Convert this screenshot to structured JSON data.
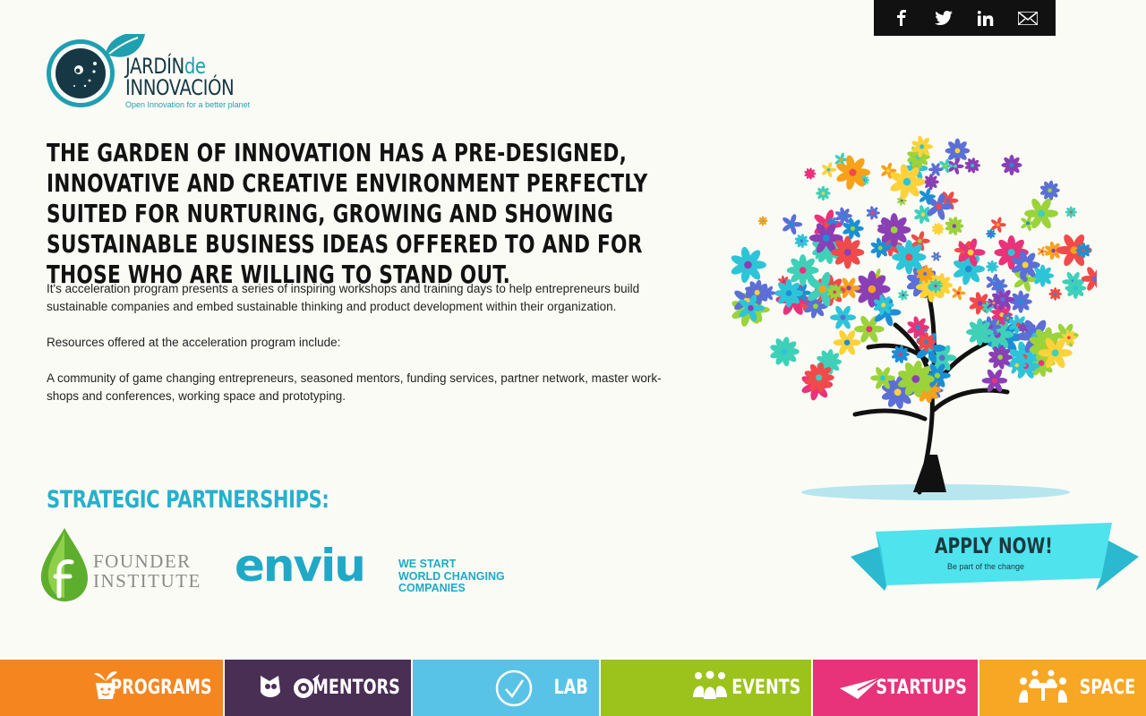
{
  "social": {
    "items": [
      {
        "name": "facebook",
        "icon": "facebook-icon"
      },
      {
        "name": "twitter",
        "icon": "twitter-icon"
      },
      {
        "name": "linkedin",
        "icon": "linkedin-icon"
      },
      {
        "name": "email",
        "icon": "mail-icon"
      }
    ]
  },
  "logo": {
    "word_jardin": "JARDÍN",
    "word_de": "de",
    "word_innovacion": "INNOVACIÓN",
    "tagline": "Open Innovation for a better planet"
  },
  "headline": "The Garden of Innovation has a pre-designed, innovative and creative environment perfectly suited for nurturing, growing and showing sustainable business ideas offered to and for those who are willing to stand out.",
  "body": {
    "p1": "It's acceleration program presents a series of inspiring workshops and training days to help entrepreneurs build sustainable companies and embed sustainable thinking and product development within their organization.",
    "p2": "Resources offered at the acceleration program include:",
    "p3": "A community of game changing entrepreneurs, seasoned mentors, funding services, partner network, master work-shops and conferences, working space and prototyping."
  },
  "partners": {
    "title": "Strategic Partnerships:",
    "founder_institute": {
      "line1": "FOUNDER",
      "line2": "INSTITUTE"
    },
    "enviu": {
      "word": "enviu",
      "tag1": "WE START",
      "tag2": "WORLD CHANGING",
      "tag3": "COMPANIES"
    }
  },
  "apply": {
    "title": "APPLY NOW!",
    "subtitle": "Be part of the change"
  },
  "nav": [
    {
      "label": "PROGRAMS",
      "color": "#f5861f",
      "icon": "seedling-pot-icon"
    },
    {
      "label": "MENTORS",
      "color": "#4a2f55",
      "icon": "owl-icon"
    },
    {
      "label": "LAB",
      "color": "#58c3e6",
      "icon": "check-circle-icon"
    },
    {
      "label": "EVENTS",
      "color": "#9bc31c",
      "icon": "people-icon"
    },
    {
      "label": "STARTUPS",
      "color": "#e8337a",
      "icon": "paper-plane-icon"
    },
    {
      "label": "SPACE",
      "color": "#f7a724",
      "icon": "table-people-icon"
    }
  ]
}
